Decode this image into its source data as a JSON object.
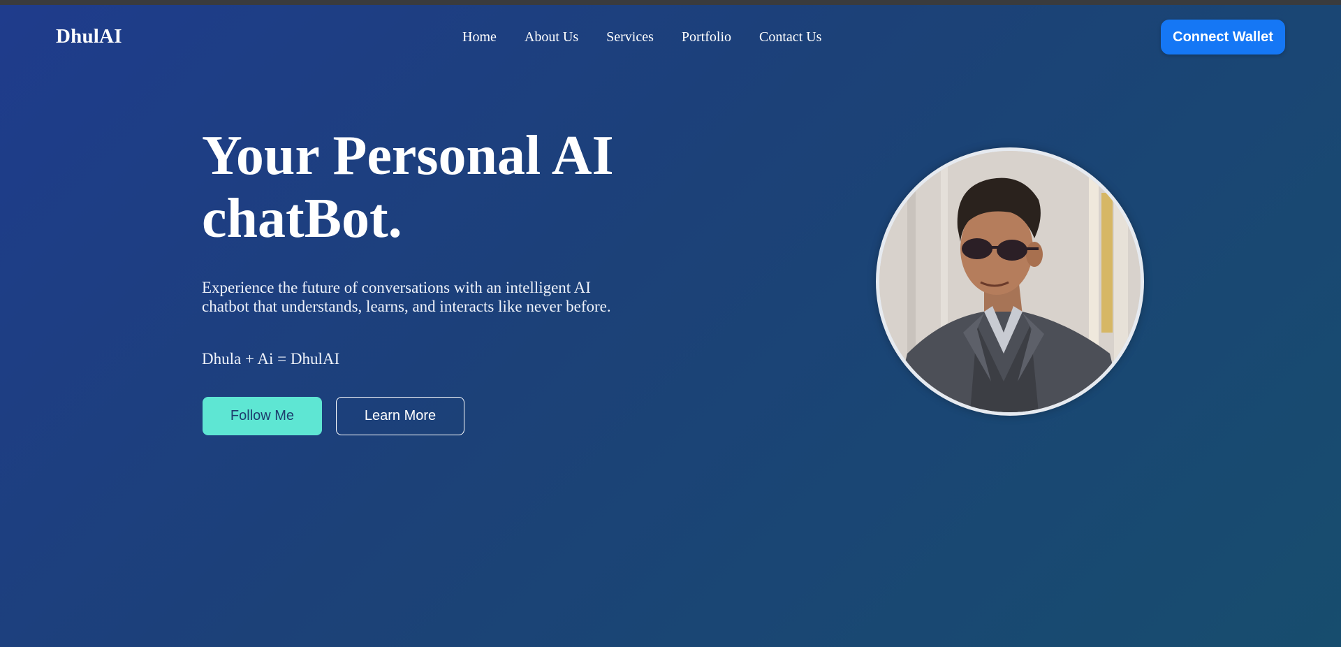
{
  "brand": {
    "name": "DhulAI"
  },
  "nav": {
    "links": [
      {
        "label": "Home"
      },
      {
        "label": "About Us"
      },
      {
        "label": "Services"
      },
      {
        "label": "Portfolio"
      },
      {
        "label": "Contact Us"
      }
    ],
    "connect_button": "Connect Wallet"
  },
  "hero": {
    "title_line1": "Your Personal AI",
    "title_line2": "chatBot.",
    "description": "Experience the future of conversations with an intelligent AI chatbot that understands, learns, and interacts like never before.",
    "formula": "Dhula + Ai = DhulAI",
    "primary_button": "Follow Me",
    "secondary_button": "Learn More",
    "profile_image": "profile-photo"
  },
  "colors": {
    "background_start": "#1f3c8c",
    "background_end": "#174d6e",
    "connect_button": "#1577f5",
    "follow_button": "#5ee6d3",
    "follow_button_text": "#1e3d6e"
  }
}
